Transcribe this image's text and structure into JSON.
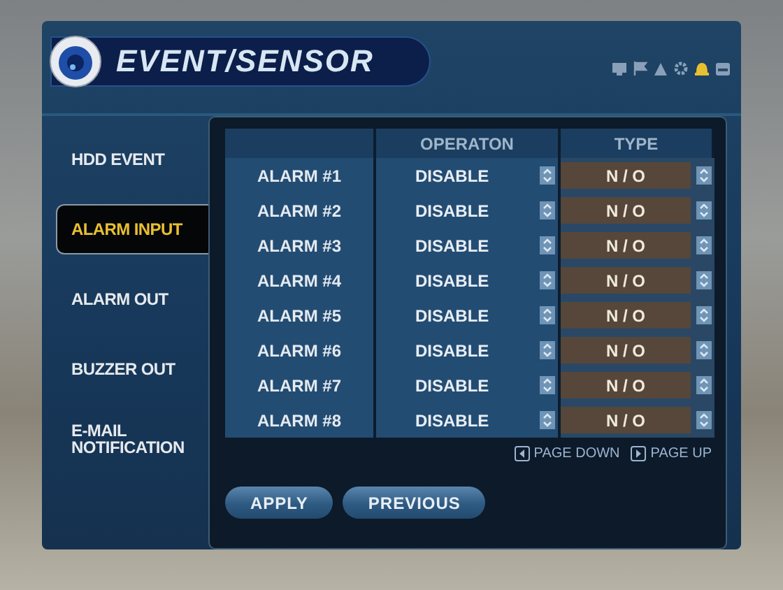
{
  "window": {
    "title": "EVENT/SENSOR"
  },
  "sidebar": {
    "items": [
      {
        "label": "HDD EVENT",
        "selected": false
      },
      {
        "label": "ALARM INPUT",
        "selected": true
      },
      {
        "label": "ALARM OUT",
        "selected": false
      },
      {
        "label": "BUZZER OUT",
        "selected": false
      },
      {
        "label": "E-MAIL NOTIFICATION",
        "selected": false
      }
    ]
  },
  "table": {
    "columns": [
      {
        "label": "OPERATON"
      },
      {
        "label": "TYPE"
      }
    ],
    "rows": [
      {
        "name": "ALARM #1",
        "operation": "DISABLE",
        "type": "N / O"
      },
      {
        "name": "ALARM #2",
        "operation": "DISABLE",
        "type": "N / O"
      },
      {
        "name": "ALARM #3",
        "operation": "DISABLE",
        "type": "N / O"
      },
      {
        "name": "ALARM #4",
        "operation": "DISABLE",
        "type": "N / O"
      },
      {
        "name": "ALARM #5",
        "operation": "DISABLE",
        "type": "N / O"
      },
      {
        "name": "ALARM #6",
        "operation": "DISABLE",
        "type": "N / O"
      },
      {
        "name": "ALARM #7",
        "operation": "DISABLE",
        "type": "N / O"
      },
      {
        "name": "ALARM #8",
        "operation": "DISABLE",
        "type": "N / O"
      }
    ]
  },
  "paging": {
    "page_down": "PAGE DOWN",
    "page_up": "PAGE UP"
  },
  "buttons": [
    "APPLY",
    "PREVIOUS"
  ]
}
